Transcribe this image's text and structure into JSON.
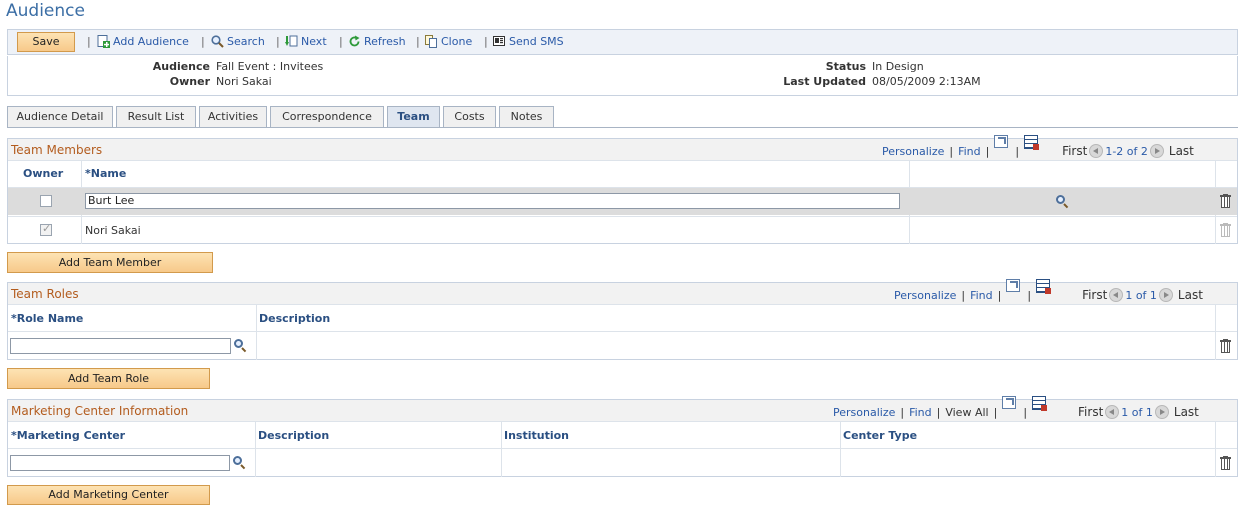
{
  "page": {
    "title": "Audience"
  },
  "toolbar": {
    "save": "Save",
    "add_audience": "Add Audience",
    "search": "Search",
    "next": "Next",
    "refresh": "Refresh",
    "clone": "Clone",
    "send_sms": "Send SMS",
    "separator": "|"
  },
  "header": {
    "audience_label": "Audience",
    "audience_value": "Fall Event : Invitees",
    "owner_label": "Owner",
    "owner_value": "Nori Sakai",
    "status_label": "Status",
    "status_value": "In Design",
    "last_updated_label": "Last Updated",
    "last_updated_value": "08/05/2009  2:13AM"
  },
  "tabs": [
    {
      "label": "Audience Detail",
      "active": false
    },
    {
      "label": "Result List",
      "active": false
    },
    {
      "label": "Activities",
      "active": false
    },
    {
      "label": "Correspondence",
      "active": false
    },
    {
      "label": "Team",
      "active": true
    },
    {
      "label": "Costs",
      "active": false
    },
    {
      "label": "Notes",
      "active": false
    }
  ],
  "nav": {
    "personalize": "Personalize",
    "find": "Find",
    "view_all": "View All",
    "first": "First",
    "last": "Last"
  },
  "team_members": {
    "title": "Team Members",
    "range": "1-2 of 2",
    "columns": {
      "owner": "Owner",
      "name": "*Name"
    },
    "rows": [
      {
        "owner": false,
        "name": "Burt Lee",
        "editable": true
      },
      {
        "owner": true,
        "name": "Nori Sakai",
        "editable": false
      }
    ],
    "add_button": "Add Team Member"
  },
  "team_roles": {
    "title": "Team Roles",
    "range": "1 of 1",
    "columns": {
      "role_name": "*Role Name",
      "description": "Description"
    },
    "rows": [
      {
        "role_name": "",
        "description": ""
      }
    ],
    "add_button": "Add Team Role"
  },
  "marketing_center": {
    "title": "Marketing Center Information",
    "range": "1 of 1",
    "columns": {
      "marketing_center": "*Marketing Center",
      "description": "Description",
      "institution": "Institution",
      "center_type": "Center Type"
    },
    "rows": [
      {
        "marketing_center": "",
        "description": "",
        "institution": "",
        "center_type": ""
      }
    ],
    "add_button": "Add Marketing Center"
  }
}
